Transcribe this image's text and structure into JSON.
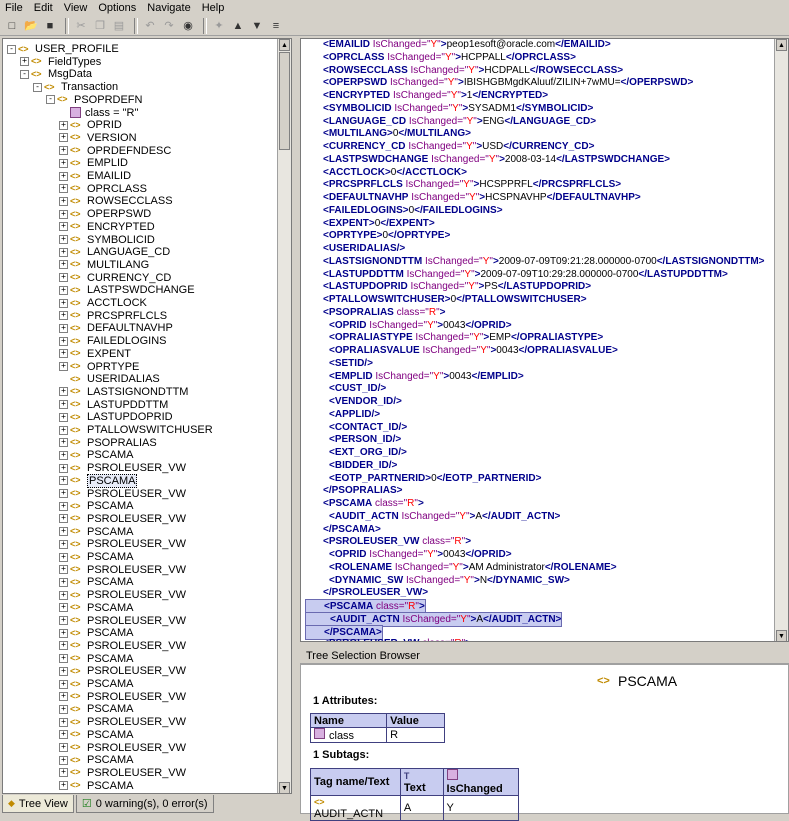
{
  "menu": [
    "File",
    "Edit",
    "View",
    "Options",
    "Navigate",
    "Help"
  ],
  "tree": [
    {
      "label": "USER_PROFILE",
      "indent": 0,
      "toggle": "-",
      "kind": "tag"
    },
    {
      "label": "FieldTypes",
      "indent": 1,
      "toggle": "+",
      "kind": "tag"
    },
    {
      "label": "MsgData",
      "indent": 1,
      "toggle": "-",
      "kind": "tag"
    },
    {
      "label": "Transaction",
      "indent": 2,
      "toggle": "-",
      "kind": "tag"
    },
    {
      "label": "PSOPRDEFN",
      "indent": 3,
      "toggle": "-",
      "kind": "tag"
    },
    {
      "label": "class = \"R\"",
      "indent": 4,
      "toggle": "",
      "kind": "attr"
    },
    {
      "label": "OPRID",
      "indent": 4,
      "toggle": "+",
      "kind": "tag"
    },
    {
      "label": "VERSION",
      "indent": 4,
      "toggle": "+",
      "kind": "tag"
    },
    {
      "label": "OPRDEFNDESC",
      "indent": 4,
      "toggle": "+",
      "kind": "tag"
    },
    {
      "label": "EMPLID",
      "indent": 4,
      "toggle": "+",
      "kind": "tag"
    },
    {
      "label": "EMAILID",
      "indent": 4,
      "toggle": "+",
      "kind": "tag"
    },
    {
      "label": "OPRCLASS",
      "indent": 4,
      "toggle": "+",
      "kind": "tag"
    },
    {
      "label": "ROWSECCLASS",
      "indent": 4,
      "toggle": "+",
      "kind": "tag"
    },
    {
      "label": "OPERPSWD",
      "indent": 4,
      "toggle": "+",
      "kind": "tag"
    },
    {
      "label": "ENCRYPTED",
      "indent": 4,
      "toggle": "+",
      "kind": "tag"
    },
    {
      "label": "SYMBOLICID",
      "indent": 4,
      "toggle": "+",
      "kind": "tag"
    },
    {
      "label": "LANGUAGE_CD",
      "indent": 4,
      "toggle": "+",
      "kind": "tag"
    },
    {
      "label": "MULTILANG",
      "indent": 4,
      "toggle": "+",
      "kind": "tag"
    },
    {
      "label": "CURRENCY_CD",
      "indent": 4,
      "toggle": "+",
      "kind": "tag"
    },
    {
      "label": "LASTPSWDCHANGE",
      "indent": 4,
      "toggle": "+",
      "kind": "tag"
    },
    {
      "label": "ACCTLOCK",
      "indent": 4,
      "toggle": "+",
      "kind": "tag"
    },
    {
      "label": "PRCSPRFLCLS",
      "indent": 4,
      "toggle": "+",
      "kind": "tag"
    },
    {
      "label": "DEFAULTNAVHP",
      "indent": 4,
      "toggle": "+",
      "kind": "tag"
    },
    {
      "label": "FAILEDLOGINS",
      "indent": 4,
      "toggle": "+",
      "kind": "tag"
    },
    {
      "label": "EXPENT",
      "indent": 4,
      "toggle": "+",
      "kind": "tag"
    },
    {
      "label": "OPRTYPE",
      "indent": 4,
      "toggle": "+",
      "kind": "tag"
    },
    {
      "label": "USERIDALIAS",
      "indent": 4,
      "toggle": "",
      "kind": "tag"
    },
    {
      "label": "LASTSIGNONDTTM",
      "indent": 4,
      "toggle": "+",
      "kind": "tag"
    },
    {
      "label": "LASTUPDDTTM",
      "indent": 4,
      "toggle": "+",
      "kind": "tag"
    },
    {
      "label": "LASTUPDOPRID",
      "indent": 4,
      "toggle": "+",
      "kind": "tag"
    },
    {
      "label": "PTALLOWSWITCHUSER",
      "indent": 4,
      "toggle": "+",
      "kind": "tag"
    },
    {
      "label": "PSOPRALIAS",
      "indent": 4,
      "toggle": "+",
      "kind": "tag"
    },
    {
      "label": "PSCAMA",
      "indent": 4,
      "toggle": "+",
      "kind": "tag"
    },
    {
      "label": "PSROLEUSER_VW",
      "indent": 4,
      "toggle": "+",
      "kind": "tag"
    },
    {
      "label": "PSCAMA",
      "indent": 4,
      "toggle": "+",
      "kind": "tag",
      "selected": true
    },
    {
      "label": "PSROLEUSER_VW",
      "indent": 4,
      "toggle": "+",
      "kind": "tag"
    },
    {
      "label": "PSCAMA",
      "indent": 4,
      "toggle": "+",
      "kind": "tag"
    },
    {
      "label": "PSROLEUSER_VW",
      "indent": 4,
      "toggle": "+",
      "kind": "tag"
    },
    {
      "label": "PSCAMA",
      "indent": 4,
      "toggle": "+",
      "kind": "tag"
    },
    {
      "label": "PSROLEUSER_VW",
      "indent": 4,
      "toggle": "+",
      "kind": "tag"
    },
    {
      "label": "PSCAMA",
      "indent": 4,
      "toggle": "+",
      "kind": "tag"
    },
    {
      "label": "PSROLEUSER_VW",
      "indent": 4,
      "toggle": "+",
      "kind": "tag"
    },
    {
      "label": "PSCAMA",
      "indent": 4,
      "toggle": "+",
      "kind": "tag"
    },
    {
      "label": "PSROLEUSER_VW",
      "indent": 4,
      "toggle": "+",
      "kind": "tag"
    },
    {
      "label": "PSCAMA",
      "indent": 4,
      "toggle": "+",
      "kind": "tag"
    },
    {
      "label": "PSROLEUSER_VW",
      "indent": 4,
      "toggle": "+",
      "kind": "tag"
    },
    {
      "label": "PSCAMA",
      "indent": 4,
      "toggle": "+",
      "kind": "tag"
    },
    {
      "label": "PSROLEUSER_VW",
      "indent": 4,
      "toggle": "+",
      "kind": "tag"
    },
    {
      "label": "PSCAMA",
      "indent": 4,
      "toggle": "+",
      "kind": "tag"
    },
    {
      "label": "PSROLEUSER_VW",
      "indent": 4,
      "toggle": "+",
      "kind": "tag"
    },
    {
      "label": "PSCAMA",
      "indent": 4,
      "toggle": "+",
      "kind": "tag"
    },
    {
      "label": "PSROLEUSER_VW",
      "indent": 4,
      "toggle": "+",
      "kind": "tag"
    },
    {
      "label": "PSCAMA",
      "indent": 4,
      "toggle": "+",
      "kind": "tag"
    },
    {
      "label": "PSROLEUSER_VW",
      "indent": 4,
      "toggle": "+",
      "kind": "tag"
    },
    {
      "label": "PSCAMA",
      "indent": 4,
      "toggle": "+",
      "kind": "tag"
    },
    {
      "label": "PSROLEUSER_VW",
      "indent": 4,
      "toggle": "+",
      "kind": "tag"
    },
    {
      "label": "PSCAMA",
      "indent": 4,
      "toggle": "+",
      "kind": "tag"
    },
    {
      "label": "PSROLEUSER_VW",
      "indent": 4,
      "toggle": "+",
      "kind": "tag"
    },
    {
      "label": "PSCAMA",
      "indent": 4,
      "toggle": "+",
      "kind": "tag"
    },
    {
      "label": "PSROLEUSER_VW",
      "indent": 4,
      "toggle": "+",
      "kind": "tag"
    }
  ],
  "tabs": [
    {
      "label": "Tree View",
      "active": true
    },
    {
      "label": "0 warning(s), 0 error(s)",
      "active": false
    }
  ],
  "xml_lines": [
    {
      "indent": 1,
      "tag": "EMAILID",
      "attr": "IsChanged",
      "val": "Y",
      "text": "peop1esoft@oracle.com",
      "close": true
    },
    {
      "indent": 1,
      "tag": "OPRCLASS",
      "attr": "IsChanged",
      "val": "Y",
      "text": "HCPPALL",
      "close": true
    },
    {
      "indent": 1,
      "tag": "ROWSECCLASS",
      "attr": "IsChanged",
      "val": "Y",
      "text": "HCDPALL",
      "close": true
    },
    {
      "indent": 1,
      "tag": "OPERPSWD",
      "attr": "IsChanged",
      "val": "Y",
      "text": "IBISHGBMgdKAluuf/ZILIN+7wMU=",
      "close": true
    },
    {
      "indent": 1,
      "tag": "ENCRYPTED",
      "attr": "IsChanged",
      "val": "Y",
      "text": "1",
      "close": true
    },
    {
      "indent": 1,
      "tag": "SYMBOLICID",
      "attr": "IsChanged",
      "val": "Y",
      "text": "SYSADM1",
      "close": true
    },
    {
      "indent": 1,
      "tag": "LANGUAGE_CD",
      "attr": "IsChanged",
      "val": "Y",
      "text": "ENG",
      "close": true
    },
    {
      "indent": 1,
      "tag": "MULTILANG",
      "text": "0",
      "close": true
    },
    {
      "indent": 1,
      "tag": "CURRENCY_CD",
      "attr": "IsChanged",
      "val": "Y",
      "text": "USD",
      "close": true
    },
    {
      "indent": 1,
      "tag": "LASTPSWDCHANGE",
      "attr": "IsChanged",
      "val": "Y",
      "text": "2008-03-14",
      "close": true
    },
    {
      "indent": 1,
      "tag": "ACCTLOCK",
      "text": "0",
      "close": true
    },
    {
      "indent": 1,
      "tag": "PRCSPRFLCLS",
      "attr": "IsChanged",
      "val": "Y",
      "text": "HCSPPRFL",
      "close": true
    },
    {
      "indent": 1,
      "tag": "DEFAULTNAVHP",
      "attr": "IsChanged",
      "val": "Y",
      "text": "HCSPNAVHP",
      "close": true
    },
    {
      "indent": 1,
      "tag": "FAILEDLOGINS",
      "text": "0",
      "close": true
    },
    {
      "indent": 1,
      "tag": "EXPENT",
      "text": "0",
      "close": true
    },
    {
      "indent": 1,
      "tag": "OPRTYPE",
      "text": "0",
      "close": true
    },
    {
      "indent": 1,
      "tag": "USERIDALIAS/",
      "raw": true
    },
    {
      "indent": 1,
      "tag": "LASTSIGNONDTTM",
      "attr": "IsChanged",
      "val": "Y",
      "text": "2009-07-09T09:21:28.000000-0700",
      "close": true
    },
    {
      "indent": 1,
      "tag": "LASTUPDDTTM",
      "attr": "IsChanged",
      "val": "Y",
      "text": "2009-07-09T10:29:28.000000-0700",
      "close": true
    },
    {
      "indent": 1,
      "tag": "LASTUPDOPRID",
      "attr": "IsChanged",
      "val": "Y",
      "text": "PS",
      "close": true
    },
    {
      "indent": 1,
      "tag": "PTALLOWSWITCHUSER",
      "text": "0",
      "close": true
    },
    {
      "indent": 1,
      "tag": "PSOPRALIAS",
      "attr": "class",
      "val": "R",
      "open": true
    },
    {
      "indent": 2,
      "tag": "OPRID",
      "attr": "IsChanged",
      "val": "Y",
      "text": "0043",
      "close": true
    },
    {
      "indent": 2,
      "tag": "OPRALIASTYPE",
      "attr": "IsChanged",
      "val": "Y",
      "text": "EMP",
      "close": true
    },
    {
      "indent": 2,
      "tag": "OPRALIASVALUE",
      "attr": "IsChanged",
      "val": "Y",
      "text": "0043",
      "close": true
    },
    {
      "indent": 2,
      "tag": "SETID/",
      "raw": true
    },
    {
      "indent": 2,
      "tag": "EMPLID",
      "attr": "IsChanged",
      "val": "Y",
      "text": "0043",
      "close": true
    },
    {
      "indent": 2,
      "tag": "CUST_ID/",
      "raw": true
    },
    {
      "indent": 2,
      "tag": "VENDOR_ID/",
      "raw": true
    },
    {
      "indent": 2,
      "tag": "APPLID/",
      "raw": true
    },
    {
      "indent": 2,
      "tag": "CONTACT_ID/",
      "raw": true
    },
    {
      "indent": 2,
      "tag": "PERSON_ID/",
      "raw": true
    },
    {
      "indent": 2,
      "tag": "EXT_ORG_ID/",
      "raw": true
    },
    {
      "indent": 2,
      "tag": "BIDDER_ID/",
      "raw": true
    },
    {
      "indent": 2,
      "tag": "EOTP_PARTNERID",
      "text": "0",
      "close": true
    },
    {
      "indent": 1,
      "tag": "/PSOPRALIAS",
      "raw": true
    },
    {
      "indent": 1,
      "tag": "PSCAMA",
      "attr": "class",
      "val": "R",
      "open": true
    },
    {
      "indent": 2,
      "tag": "AUDIT_ACTN",
      "attr": "IsChanged",
      "val": "Y",
      "text": "A",
      "close": true
    },
    {
      "indent": 1,
      "tag": "/PSCAMA",
      "raw": true
    },
    {
      "indent": 1,
      "tag": "PSROLEUSER_VW",
      "attr": "class",
      "val": "R",
      "open": true
    },
    {
      "indent": 2,
      "tag": "OPRID",
      "attr": "IsChanged",
      "val": "Y",
      "text": "0043",
      "close": true
    },
    {
      "indent": 2,
      "tag": "ROLENAME",
      "attr": "IsChanged",
      "val": "Y",
      "text": "AM Administrator",
      "close": true
    },
    {
      "indent": 2,
      "tag": "DYNAMIC_SW",
      "attr": "IsChanged",
      "val": "Y",
      "text": "N",
      "close": true
    },
    {
      "indent": 1,
      "tag": "/PSROLEUSER_VW",
      "raw": true
    },
    {
      "indent": 1,
      "tag": "PSCAMA",
      "attr": "class",
      "val": "R",
      "open": true,
      "hl": true
    },
    {
      "indent": 2,
      "tag": "AUDIT_ACTN",
      "attr": "IsChanged",
      "val": "Y",
      "text": "A",
      "close": true,
      "hl": true
    },
    {
      "indent": 1,
      "tag": "/PSCAMA",
      "raw": true,
      "hl": true
    },
    {
      "indent": 1,
      "tag": "PSROLEUSER_VW",
      "attr": "class",
      "val": "R",
      "open": true
    }
  ],
  "tsb": {
    "header": "Tree Selection Browser",
    "title": "PSCAMA",
    "attributes_heading": "1 Attributes:",
    "attr_cols": [
      "Name",
      "Value"
    ],
    "attr_rows": [
      [
        "class",
        "R"
      ]
    ],
    "subtags_heading": "1 Subtags:",
    "sub_cols": [
      "Tag name/Text",
      "Text",
      "IsChanged"
    ],
    "sub_rows": [
      [
        "AUDIT_ACTN",
        "A",
        "Y"
      ]
    ]
  }
}
